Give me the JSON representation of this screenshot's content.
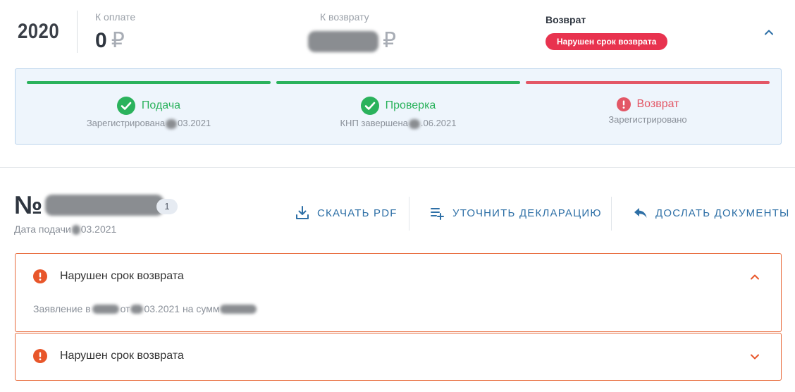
{
  "summary": {
    "year": "2020",
    "to_pay_label": "К оплате",
    "to_pay_value": "0",
    "currency": "₽",
    "refund_label": "К возврату",
    "status_title": "Возврат",
    "status_badge": "Нарушен срок возврата"
  },
  "progress": {
    "steps": [
      {
        "title": "Подача",
        "subtitle": "Зарегистрирована",
        "date_suffix": "03.2021",
        "state": "done",
        "color": "#2ab25c"
      },
      {
        "title": "Проверка",
        "subtitle": "КНП завершена",
        "date_suffix": ".06.2021",
        "state": "done",
        "color": "#2ab25c"
      },
      {
        "title": "Возврат",
        "subtitle": "Зарегистрировано",
        "state": "error",
        "color": "#e35766"
      }
    ]
  },
  "declaration": {
    "number_prefix": "№",
    "count": "1",
    "date_label": "Дата подачи",
    "date_suffix": "03.2021",
    "actions": [
      {
        "label": "СКАЧАТЬ PDF",
        "icon": "download-icon"
      },
      {
        "label": "УТОЧНИТЬ ДЕКЛАРАЦИЮ",
        "icon": "playlist-add-icon"
      },
      {
        "label": "ДОСЛАТЬ ДОКУМЕНТЫ",
        "icon": "reply-icon"
      }
    ]
  },
  "alerts": [
    {
      "title": "Нарушен срок возврата",
      "expanded": true,
      "text_prefix": "Заявление в",
      "text_mid": "от",
      "text_date": "03.2021 на сумм"
    },
    {
      "title": "Нарушен срок возврата",
      "expanded": false
    }
  ],
  "colors": {
    "accent": "#2d6fa6",
    "success": "#2ab25c",
    "error": "#e8334f",
    "warning": "#e8562a"
  }
}
